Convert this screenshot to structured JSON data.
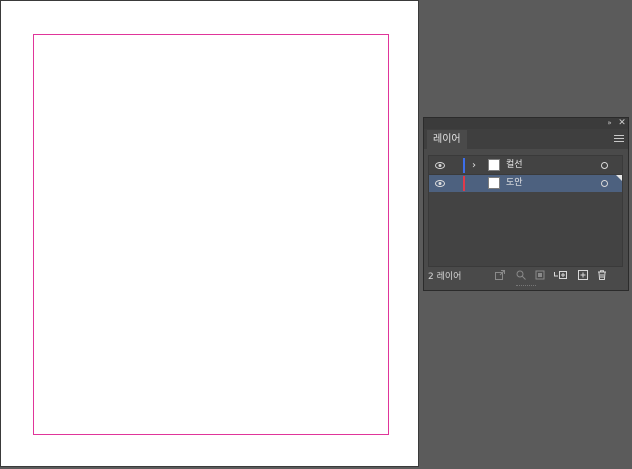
{
  "layers_panel": {
    "tab_label": "레이어",
    "collapse_glyph": "»",
    "close_glyph": "✕",
    "layers": [
      {
        "name": "컬선",
        "color": "#3d6ee8",
        "expand_glyph": "›",
        "selected": false
      },
      {
        "name": "도안",
        "color": "#e03a4a",
        "expand_glyph": "",
        "selected": true
      }
    ],
    "footer": {
      "count_label": "2 레이어"
    }
  },
  "artboard": {
    "guide_color": "#e0359a"
  }
}
